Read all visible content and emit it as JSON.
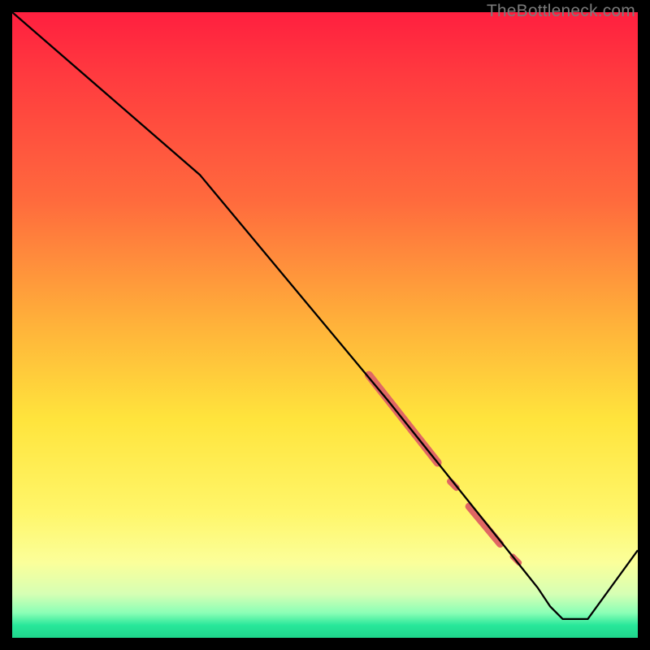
{
  "watermark": "TheBottleneck.com",
  "colors": {
    "background": "#000000",
    "gradient_top": "#ff1f3f",
    "gradient_mid1": "#ff6a3d",
    "gradient_mid2": "#ffe43c",
    "gradient_mid3": "#fbff9a",
    "gradient_bottom": "#1fd58c",
    "line": "#000000",
    "marker": "#e06763"
  },
  "chart_data": {
    "type": "line",
    "title": "",
    "xlabel": "",
    "ylabel": "",
    "xlim": [
      0,
      100
    ],
    "ylim": [
      0,
      100
    ],
    "grid": false,
    "series": [
      {
        "name": "curve",
        "x": [
          0,
          30,
          60,
          64,
          66,
          68,
          70,
          72,
          74,
          76,
          78,
          80,
          82,
          84,
          86,
          88,
          92,
          100
        ],
        "values": [
          100,
          74,
          38,
          33,
          30.5,
          28,
          25.5,
          23,
          20.5,
          18,
          15.5,
          13,
          10.5,
          8,
          5,
          3,
          3,
          14
        ]
      }
    ],
    "marker_segments": [
      {
        "x_start": 57,
        "y_start": 42,
        "x_end": 68,
        "y_end": 28,
        "width": 10
      },
      {
        "x_start": 70,
        "y_start": 25,
        "x_end": 71,
        "y_end": 24,
        "width": 8
      },
      {
        "x_start": 73,
        "y_start": 21,
        "x_end": 78,
        "y_end": 15,
        "width": 9
      },
      {
        "x_start": 80,
        "y_start": 13,
        "x_end": 81,
        "y_end": 12,
        "width": 7
      }
    ],
    "annotations": []
  }
}
